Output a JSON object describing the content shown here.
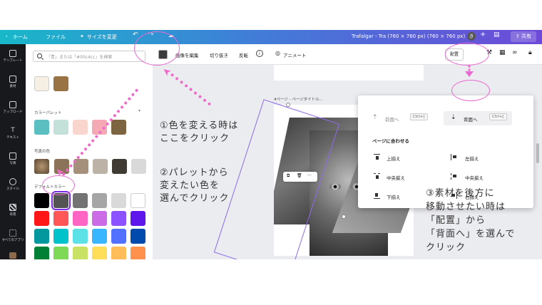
{
  "header": {
    "back_label": "ホーム",
    "file_label": "ファイル",
    "resize_label": "サイズを変更",
    "doc_title": "Trafalgar - Tra (760 × 760 px) (760 × 760 px)",
    "share_label": "共有",
    "avatar_letter": "き"
  },
  "rail": {
    "items": [
      "テンプレート",
      "素材",
      "アップロード",
      "テキスト",
      "写真",
      "スタイル",
      "背景",
      "すべてのアプリ"
    ]
  },
  "panel": {
    "search_placeholder": "「青」または「#00c4cc」を検索",
    "palette_title": "カラーパレット",
    "photo_colors_title": "写真の色",
    "default_colors_title": "デフォルトカラー",
    "recent_colors": [
      "#f6efe3",
      "#9a7345"
    ],
    "palette_colors": [
      "#5bbfc1",
      "#c3e1d8",
      "#f9d6cd",
      "#f5a9b4",
      "#7e6541"
    ],
    "photo_colors": [
      "#8b7359",
      "#a4907b",
      "#bcb3a6",
      "#3f3a33",
      "#d9d9d9"
    ],
    "default_colors": [
      [
        "#000000",
        "#545454",
        "#737373",
        "#a6a6a6",
        "#d9d9d9",
        "#ffffff"
      ],
      [
        "#ff1616",
        "#ff5757",
        "#ff66c4",
        "#cb6ce6",
        "#8c52ff",
        "#5e17eb"
      ],
      [
        "#03989e",
        "#00c2cb",
        "#5ce1e6",
        "#38b6ff",
        "#5271ff",
        "#004aad"
      ],
      [
        "#008037",
        "#7ed957",
        "#c9e265",
        "#ffde59",
        "#ffbd59",
        "#ff914d"
      ]
    ],
    "selected_color": "#545454"
  },
  "toolbar": {
    "edit_image": "画像を編集",
    "crop": "切り抜き",
    "flip": "反転",
    "animate": "アニメート",
    "arrange": "配置",
    "info_glyph": "i"
  },
  "canvas": {
    "page_label": "4ページ - ページタイトル...",
    "dots": "···"
  },
  "arrange_menu": {
    "forward": "前面へ",
    "forward_key": "Ctrl+]",
    "backward": "背面へ",
    "backward_key": "Ctrl+[",
    "align_to_page": "ページに合わせる",
    "top": "上揃え",
    "middle": "中央揃え",
    "bottom": "下揃え",
    "left": "左揃え",
    "center": "中央揃え",
    "right": "右揃え"
  },
  "annotations": {
    "note1_line1": "①色を変える時は",
    "note1_line2": "ここをクリック",
    "note2_line1": "②パレットから",
    "note2_line2": "変えたい色を",
    "note2_line3": "選んでクリック",
    "note3_line1": "③素材を後方に",
    "note3_line2": "移動させたい時は",
    "note3_line3": "「配置」から",
    "note3_line4": "「背面へ」を選んで",
    "note3_line5": "クリック"
  },
  "colors": {
    "accent": "#7d2ae8",
    "annotation_pink": "#e86bd0"
  }
}
